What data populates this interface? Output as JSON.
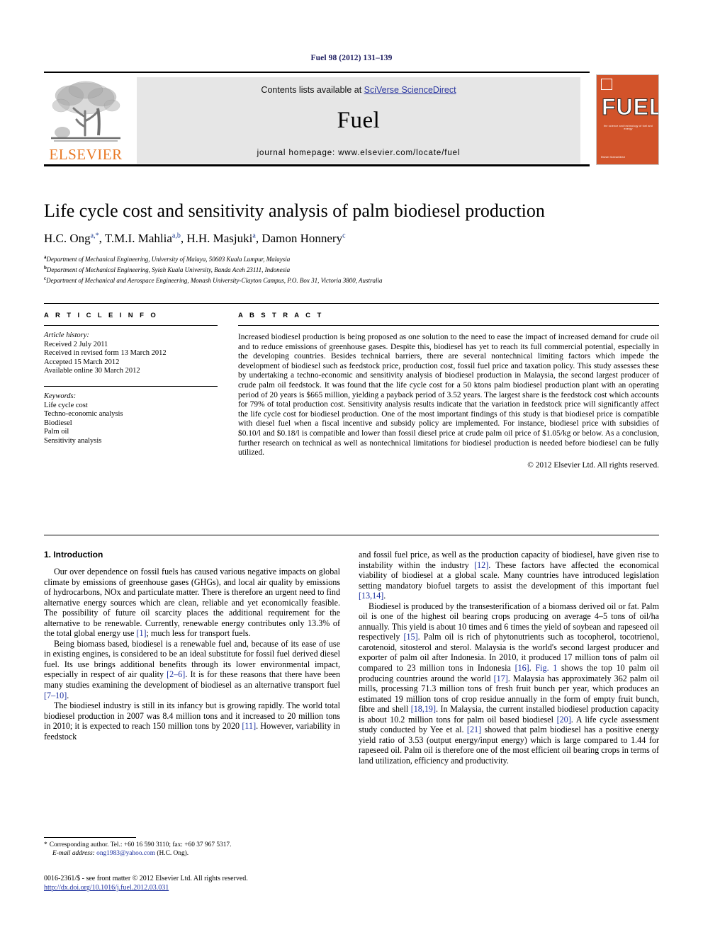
{
  "running_head": "Fuel 98 (2012) 131–139",
  "masthead": {
    "contents_prefix": "Contents lists available at ",
    "contents_link": "SciVerse ScienceDirect",
    "journal_title": "Fuel",
    "homepage": "journal homepage: www.elsevier.com/locate/fuel",
    "publisher_wordmark": "ELSEVIER",
    "cover": {
      "title": "FUEL",
      "subtitle": "the science and technology of fuel and energy",
      "footer": "Elsevier ScienceDirect"
    }
  },
  "article": {
    "title": "Life cycle cost and sensitivity analysis of palm biodiesel production",
    "authors": [
      {
        "name": "H.C. Ong",
        "marks": "a,*"
      },
      {
        "name": "T.M.I. Mahlia",
        "marks": "a,b"
      },
      {
        "name": "H.H. Masjuki",
        "marks": "a"
      },
      {
        "name": "Damon Honnery",
        "marks": "c"
      }
    ],
    "affiliations": [
      {
        "mark": "a",
        "text": "Department of Mechanical Engineering, University of Malaya, 50603 Kuala Lumpur, Malaysia"
      },
      {
        "mark": "b",
        "text": "Department of Mechanical Engineering, Syiah Kuala University, Banda Aceh 23111, Indonesia"
      },
      {
        "mark": "c",
        "text": "Department of Mechanical and Aerospace Engineering, Monash University-Clayton Campus, P.O. Box 31, Victoria 3800, Australia"
      }
    ]
  },
  "article_info": {
    "heading": "A R T I C L E  I N F O",
    "history_label": "Article history:",
    "history": [
      "Received 2 July 2011",
      "Received in revised form 13 March 2012",
      "Accepted 15 March 2012",
      "Available online 30 March 2012"
    ],
    "keywords_label": "Keywords:",
    "keywords": [
      "Life cycle cost",
      "Techno-economic analysis",
      "Biodiesel",
      "Palm oil",
      "Sensitivity analysis"
    ]
  },
  "abstract": {
    "heading": "A B S T R A C T",
    "text": "Increased biodiesel production is being proposed as one solution to the need to ease the impact of increased demand for crude oil and to reduce emissions of greenhouse gases. Despite this, biodiesel has yet to reach its full commercial potential, especially in the developing countries. Besides technical barriers, there are several nontechnical limiting factors which impede the development of biodiesel such as feedstock price, production cost, fossil fuel price and taxation policy. This study assesses these by undertaking a techno-economic and sensitivity analysis of biodiesel production in Malaysia, the second largest producer of crude palm oil feedstock. It was found that the life cycle cost for a 50 ktons palm biodiesel production plant with an operating period of 20 years is $665 million, yielding a payback period of 3.52 years. The largest share is the feedstock cost which accounts for 79% of total production cost. Sensitivity analysis results indicate that the variation in feedstock price will significantly affect the life cycle cost for biodiesel production. One of the most important findings of this study is that biodiesel price is compatible with diesel fuel when a fiscal incentive and subsidy policy are implemented. For instance, biodiesel price with subsidies of $0.10/l and $0.18/l is compatible and lower than fossil diesel price at crude palm oil price of $1.05/kg or below. As a conclusion, further research on technical as well as nontechnical limitations for biodiesel production is needed before biodiesel can be fully utilized.",
    "copyright": "© 2012 Elsevier Ltd. All rights reserved."
  },
  "body": {
    "section_title": "1. Introduction",
    "left_paragraphs": [
      "Our over dependence on fossil fuels has caused various negative impacts on global climate by emissions of greenhouse gases (GHGs), and local air quality by emissions of hydrocarbons, NOx and particulate matter. There is therefore an urgent need to find alternative energy sources which are clean, reliable and yet economically feasible. The possibility of future oil scarcity places the additional requirement for the alternative to be renewable. Currently, renewable energy contributes only 13.3% of the total global energy use [1]; much less for transport fuels.",
      "Being biomass based, biodiesel is a renewable fuel and, because of its ease of use in existing engines, is considered to be an ideal substitute for fossil fuel derived diesel fuel. Its use brings additional benefits through its lower environmental impact, especially in respect of air quality [2–6]. It is for these reasons that there have been many studies examining the development of biodiesel as an alternative transport fuel [7–10].",
      "The biodiesel industry is still in its infancy but is growing rapidly. The world total biodiesel production in 2007 was 8.4 million tons and it increased to 20 million tons in 2010; it is expected to reach 150 million tons by 2020 [11]. However, variability in feedstock"
    ],
    "right_paragraphs": [
      "and fossil fuel price, as well as the production capacity of biodiesel, have given rise to instability within the industry [12]. These factors have affected the economical viability of biodiesel at a global scale. Many countries have introduced legislation setting mandatory biofuel targets to assist the development of this important fuel [13,14].",
      "Biodiesel is produced by the transesterification of a biomass derived oil or fat. Palm oil is one of the highest oil bearing crops producing on average 4–5 tons of oil/ha annually. This yield is about 10 times and 6 times the yield of soybean and rapeseed oil respectively [15]. Palm oil is rich of phytonutrients such as tocopherol, tocotrienol, carotenoid, sitosterol and sterol. Malaysia is the world's second largest producer and exporter of palm oil after Indonesia. In 2010, it produced 17 million tons of palm oil compared to 23 million tons in Indonesia [16]. Fig. 1 shows the top 10 palm oil producing countries around the world [17]. Malaysia has approximately 362 palm oil mills, processing 71.3 million tons of fresh fruit bunch per year, which produces an estimated 19 million tons of crop residue annually in the form of empty fruit bunch, fibre and shell [18,19]. In Malaysia, the current installed biodiesel production capacity is about 10.2 million tons for palm oil based biodiesel [20]. A life cycle assessment study conducted by Yee et al. [21] showed that palm biodiesel has a positive energy yield ratio of 3.53 (output energy/input energy) which is large compared to 1.44 for rapeseed oil. Palm oil is therefore one of the most efficient oil bearing crops in terms of land utilization, efficiency and productivity."
    ]
  },
  "footnote": {
    "marker": "*",
    "corresponding": "Corresponding author. Tel.: +60 16 590 3110; fax: +60 37 967 5317.",
    "email_label": "E-mail address:",
    "email": "ong1983@yahoo.com",
    "email_owner": "(H.C. Ong)."
  },
  "footer": {
    "issn_line": "0016-2361/$ - see front matter © 2012 Elsevier Ltd. All rights reserved.",
    "doi": "http://dx.doi.org/10.1016/j.fuel.2012.03.031"
  },
  "colors": {
    "elsevier_orange": "#E87722",
    "link_blue": "#1c2f9e",
    "masthead_grey": "#e6e6e6",
    "cover_orange": "#D2532A"
  }
}
